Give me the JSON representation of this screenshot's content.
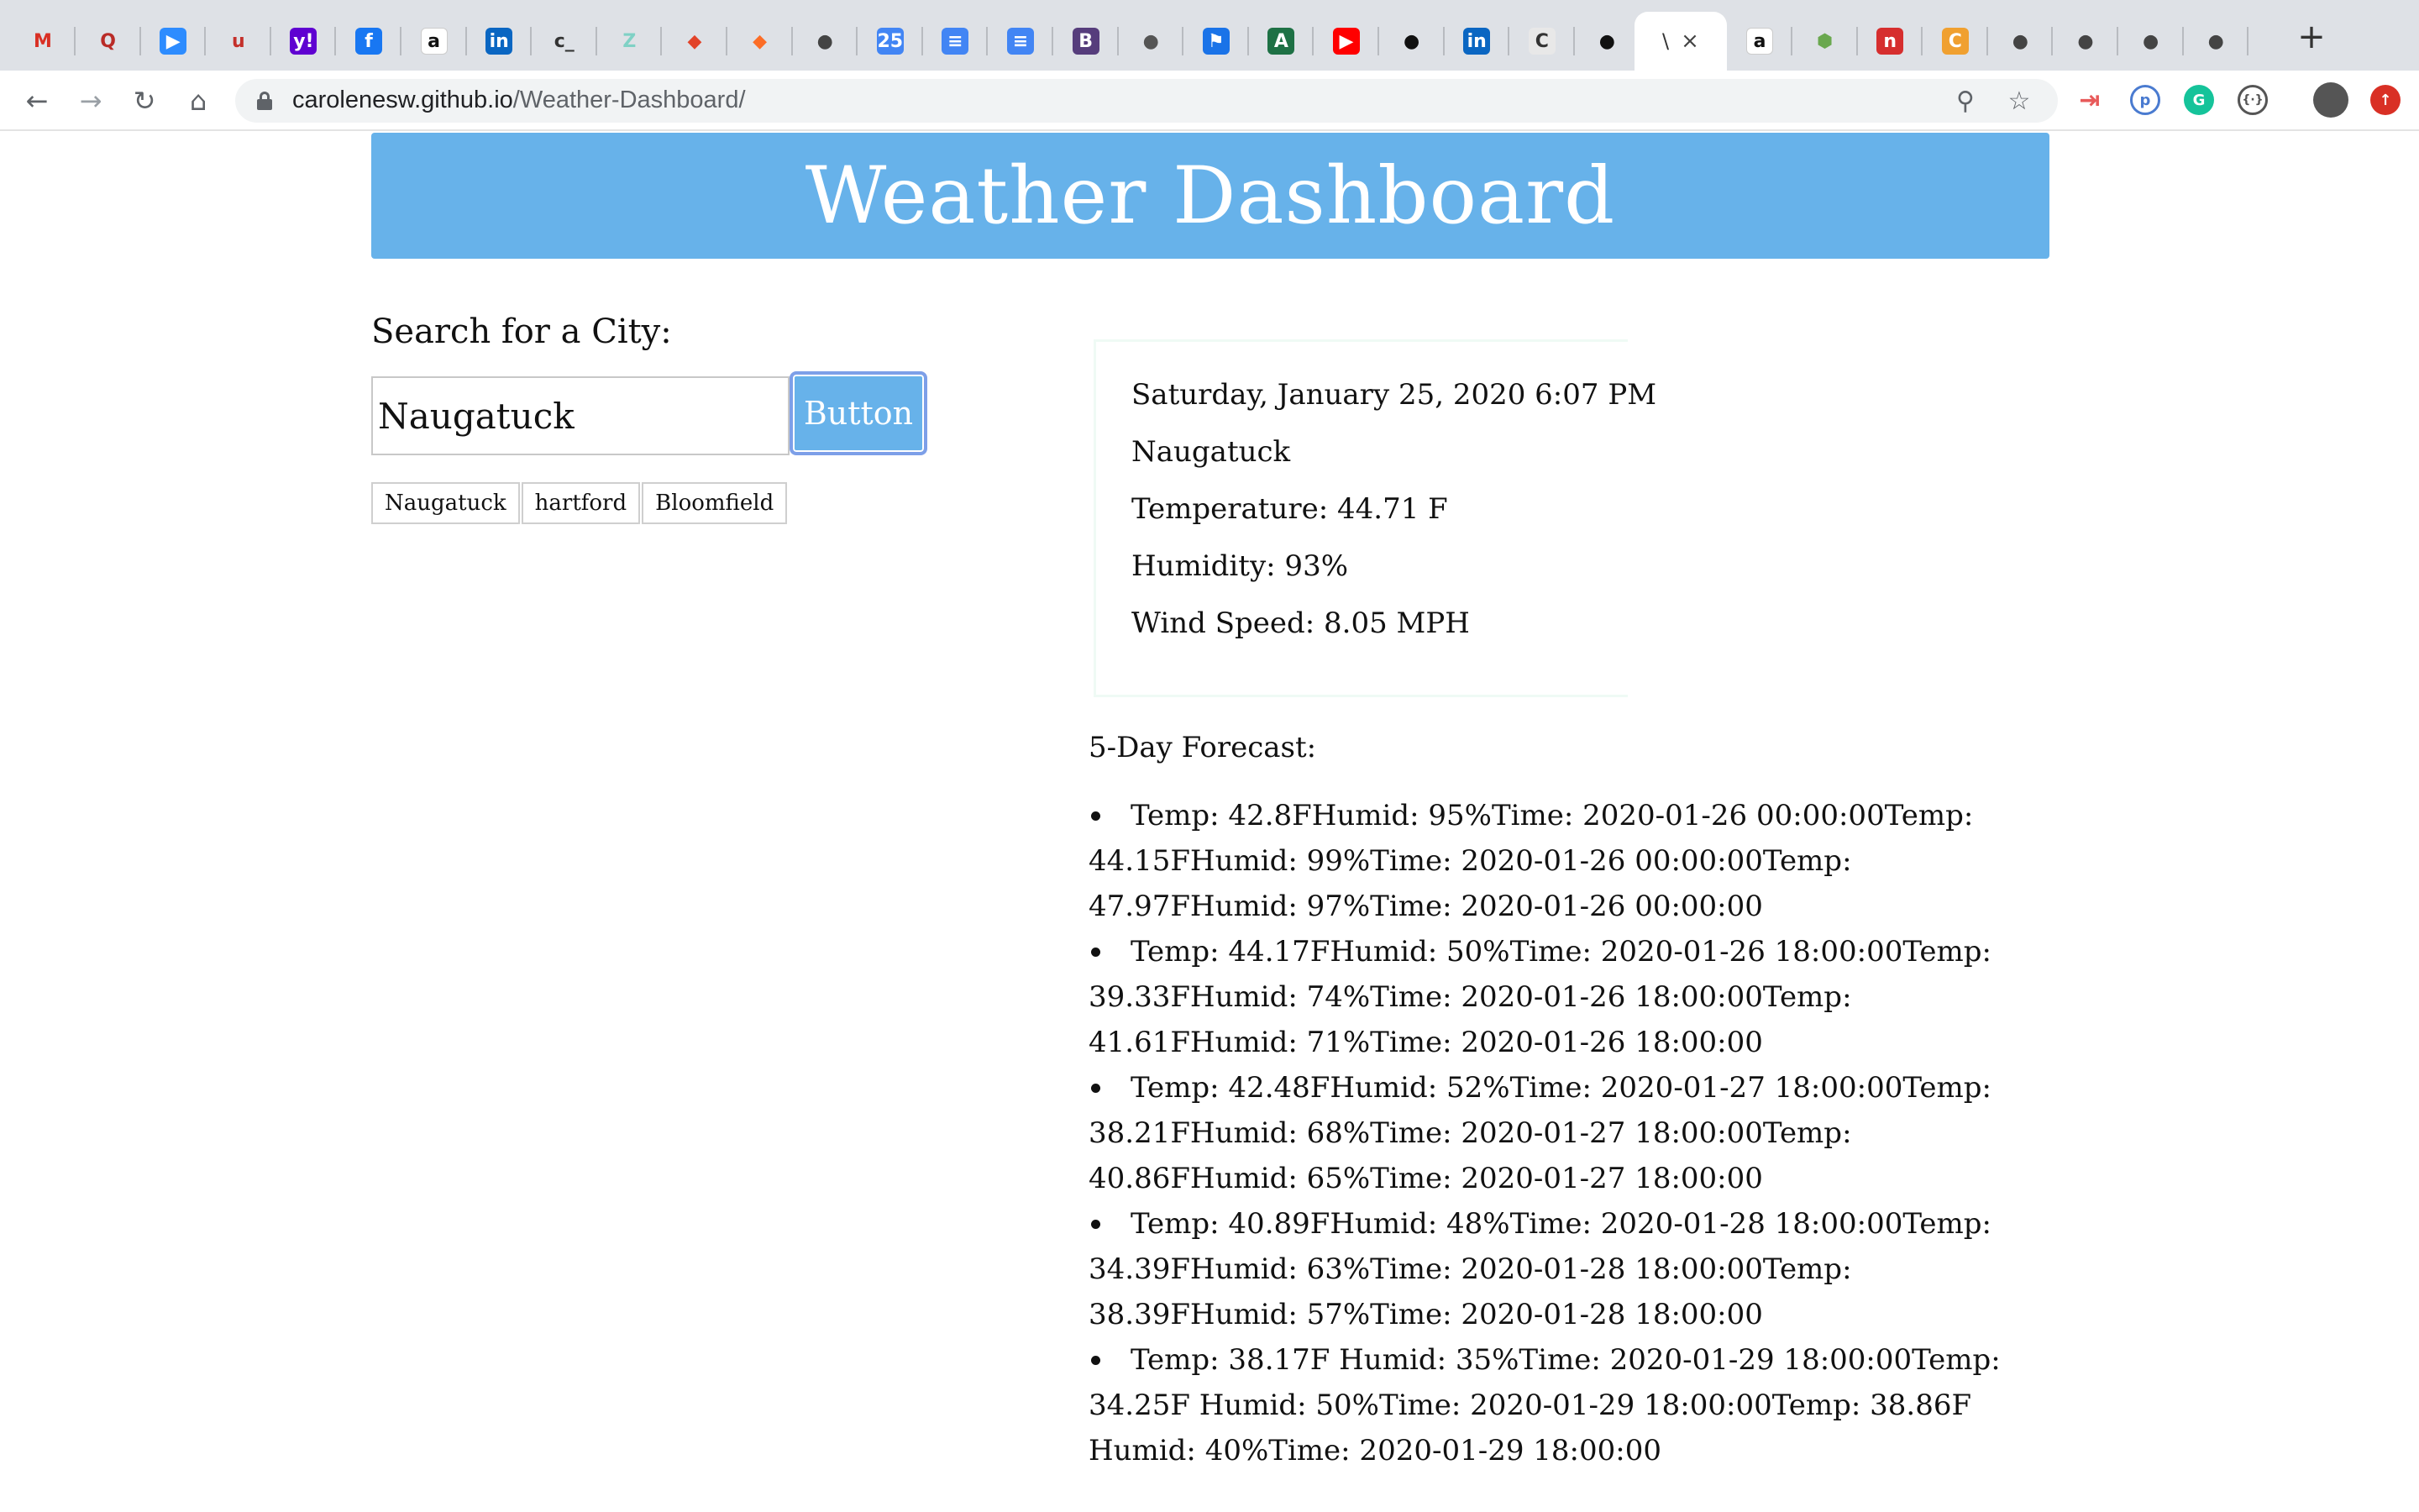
{
  "browser": {
    "tabs": [
      {
        "icon": "gmail-icon",
        "glyph": "M",
        "color": "#d93025",
        "bg": "transparent"
      },
      {
        "icon": "quora-icon",
        "glyph": "Q",
        "color": "#b92b27",
        "bg": "transparent"
      },
      {
        "icon": "zoom-icon",
        "glyph": "▶",
        "color": "#ffffff",
        "bg": "#2d8cff"
      },
      {
        "icon": "udemy-icon",
        "glyph": "u",
        "color": "#c4302b",
        "bg": "transparent"
      },
      {
        "icon": "yahoo-icon",
        "glyph": "y!",
        "color": "#ffffff",
        "bg": "#5f01d1"
      },
      {
        "icon": "facebook-icon",
        "glyph": "f",
        "color": "#ffffff",
        "bg": "#1877f2"
      },
      {
        "icon": "amazon-icon",
        "glyph": "a",
        "color": "#111111",
        "bg": "#ffffff"
      },
      {
        "icon": "linkedin-icon",
        "glyph": "in",
        "color": "#ffffff",
        "bg": "#0a66c2"
      },
      {
        "icon": "terminal-icon",
        "glyph": "c_",
        "color": "#333333",
        "bg": "transparent"
      },
      {
        "icon": "zendesk-icon",
        "glyph": "Z",
        "color": "#7fd1c5",
        "bg": "transparent"
      },
      {
        "icon": "gitlab-icon",
        "glyph": "◆",
        "color": "#e24329",
        "bg": "transparent"
      },
      {
        "icon": "gitlab-icon",
        "glyph": "◆",
        "color": "#fc6d26",
        "bg": "transparent"
      },
      {
        "icon": "globe-icon",
        "glyph": "●",
        "color": "#444444",
        "bg": "transparent"
      },
      {
        "icon": "calendar-icon",
        "glyph": "25",
        "color": "#ffffff",
        "bg": "#4285f4"
      },
      {
        "icon": "docs-icon",
        "glyph": "≡",
        "color": "#ffffff",
        "bg": "#4285f4"
      },
      {
        "icon": "docs-icon",
        "glyph": "≡",
        "color": "#ffffff",
        "bg": "#4285f4"
      },
      {
        "icon": "bootstrap-icon",
        "glyph": "B",
        "color": "#ffffff",
        "bg": "#563d7c"
      },
      {
        "icon": "apple-icon",
        "glyph": "●",
        "color": "#555555",
        "bg": "transparent"
      },
      {
        "icon": "flag-icon",
        "glyph": "⚑",
        "color": "#ffffff",
        "bg": "#1a73e8"
      },
      {
        "icon": "spreadsheet-icon",
        "glyph": "A",
        "color": "#ffffff",
        "bg": "#1e7145"
      },
      {
        "icon": "youtube-icon",
        "glyph": "▶",
        "color": "#ffffff",
        "bg": "#ff0000"
      },
      {
        "icon": "github-icon",
        "glyph": "●",
        "color": "#111111",
        "bg": "transparent"
      },
      {
        "icon": "linkedin-icon",
        "glyph": "in",
        "color": "#ffffff",
        "bg": "#0a66c2"
      },
      {
        "icon": "codecademy-icon",
        "glyph": "C",
        "color": "#333333",
        "bg": "#e8e8e8"
      },
      {
        "icon": "github-icon",
        "glyph": "●",
        "color": "#111111",
        "bg": "transparent"
      }
    ],
    "active_tab": {
      "title": "\\",
      "close": "×"
    },
    "tabs_after": [
      {
        "icon": "amazon-icon",
        "glyph": "a",
        "color": "#111111",
        "bg": "#ffffff"
      },
      {
        "icon": "nodejs-icon",
        "glyph": "⬢",
        "color": "#6aa84f",
        "bg": "transparent"
      },
      {
        "icon": "netlify-icon",
        "glyph": "n",
        "color": "#ffffff",
        "bg": "#d62e2e"
      },
      {
        "icon": "coin-icon",
        "glyph": "C",
        "color": "#ffffff",
        "bg": "#f0a030"
      },
      {
        "icon": "globe-icon",
        "glyph": "●",
        "color": "#444444",
        "bg": "transparent"
      },
      {
        "icon": "globe-icon",
        "glyph": "●",
        "color": "#444444",
        "bg": "transparent"
      },
      {
        "icon": "globe-icon",
        "glyph": "●",
        "color": "#444444",
        "bg": "transparent"
      },
      {
        "icon": "globe-icon",
        "glyph": "●",
        "color": "#444444",
        "bg": "transparent"
      }
    ],
    "new_tab": "+",
    "url_host": "carolenesw.github.io",
    "url_path": "/Weather-Dashboard/"
  },
  "page": {
    "title": "Weather Dashboard",
    "search_label": "Search for a City:",
    "search_value": "Naugatuck",
    "search_button": "Button",
    "history": [
      "Naugatuck",
      "hartford",
      "Bloomfield"
    ],
    "current": {
      "datetime": "Saturday, January 25, 2020 6:07 PM",
      "city": "Naugatuck",
      "temperature": "Temperature: 44.71 F",
      "humidity": "Humidity: 93%",
      "wind": "Wind Speed: 8.05 MPH"
    },
    "forecast_label": "5-Day Forecast:",
    "forecast": [
      "Temp: 42.8FHumid: 95%Time: 2020-01-26 00:00:00Temp: 44.15FHumid: 99%Time: 2020-01-26 00:00:00Temp: 47.97FHumid: 97%Time: 2020-01-26 00:00:00",
      "Temp: 44.17FHumid: 50%Time: 2020-01-26 18:00:00Temp: 39.33FHumid: 74%Time: 2020-01-26 18:00:00Temp: 41.61FHumid: 71%Time: 2020-01-26 18:00:00",
      "Temp: 42.48FHumid: 52%Time: 2020-01-27 18:00:00Temp: 38.21FHumid: 68%Time: 2020-01-27 18:00:00Temp: 40.86FHumid: 65%Time: 2020-01-27 18:00:00",
      "Temp: 40.89FHumid: 48%Time: 2020-01-28 18:00:00Temp: 34.39FHumid: 63%Time: 2020-01-28 18:00:00Temp: 38.39FHumid: 57%Time: 2020-01-28 18:00:00",
      "Temp: 38.17F Humid: 35%Time: 2020-01-29 18:00:00Temp: 34.25F Humid: 50%Time: 2020-01-29 18:00:00Temp: 38.86F Humid: 40%Time: 2020-01-29 18:00:00"
    ]
  }
}
